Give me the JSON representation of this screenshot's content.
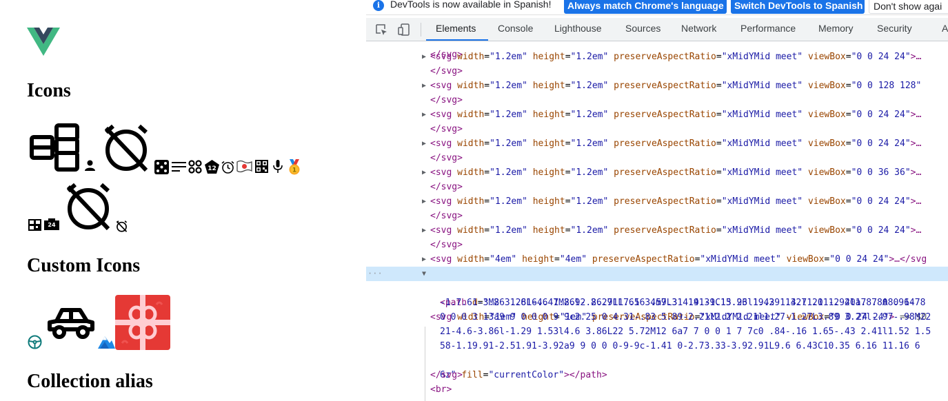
{
  "page": {
    "logo": "vue-logo",
    "headings": {
      "icons": "Icons",
      "custom_icons": "Custom Icons",
      "collection_alias": "Collection alias"
    },
    "icons": [
      "dashboard-icon",
      "person-icon",
      "alarm-off-icon",
      "dice-icon",
      "text-align-icon",
      "apps-icon",
      "badge-12-icon",
      "clock-icon",
      "flag-japan-icon",
      "qr-code-icon",
      "microphone-icon",
      "medal-gold-icon",
      "qr-code-icon",
      "24-hours-icon",
      "alarm-off-icon",
      "alarm-off-icon"
    ],
    "custom_icons": [
      "steering-wheel-icon",
      "car-icon",
      "mountains-icon",
      "gift-icon"
    ],
    "colors": {
      "vue_green": "#41b883",
      "vue_dark": "#34495e",
      "gift_red": "#e53935",
      "steering_teal": "#0e7a7a"
    }
  },
  "devtools": {
    "infobar": {
      "text": "DevTools is now available in Spanish!",
      "match_button": "Always match Chrome's language",
      "switch_button": "Switch DevTools to Spanish",
      "dismiss_button": "Don't show agai"
    },
    "tabs": [
      {
        "label": "Elements",
        "active": true
      },
      {
        "label": "Console"
      },
      {
        "label": "Lighthouse"
      },
      {
        "label": "Sources"
      },
      {
        "label": "Network"
      },
      {
        "label": "Performance"
      },
      {
        "label": "Memory"
      },
      {
        "label": "Security"
      },
      {
        "label": "A"
      }
    ],
    "dom_lines": {
      "close_top": "</svg>",
      "svg1": {
        "w": "1.2em",
        "h": "1.2em",
        "par": "xMidYMid meet",
        "vb": "0 0 24 24",
        "tail": ">…"
      },
      "svg2": {
        "w": "1.2em",
        "h": "1.2em",
        "par": "xMidYMid meet",
        "vb": "0 0 128 128",
        "tail": ""
      },
      "svg3": {
        "w": "1.2em",
        "h": "1.2em",
        "par": "xMidYMid meet",
        "vb": "0 0 24 24",
        "tail": ">…"
      },
      "svg4": {
        "w": "1.2em",
        "h": "1.2em",
        "par": "xMidYMid meet",
        "vb": "0 0 24 24",
        "tail": ">…"
      },
      "svg5": {
        "w": "1.2em",
        "h": "1.2em",
        "par": "xMidYMid meet",
        "vb": "0 0 36 36",
        "tail": ">…"
      },
      "svg6": {
        "w": "1.2em",
        "h": "1.2em",
        "par": "xMidYMid meet",
        "vb": "0 0 24 24",
        "tail": ">…"
      },
      "svg7": {
        "w": "1.2em",
        "h": "1.2em",
        "par": "xMidYMid meet",
        "vb": "0 0 24 24",
        "tail": ">…"
      },
      "svg8": {
        "w": "4em",
        "h": "4em",
        "par": "xMidYMid meet",
        "vb": "0 0 24 24",
        "tail": ">…</svg"
      },
      "svg9": {
        "w": "1em",
        "h": "1em",
        "par": "xMidYMid meet",
        "vb": "0 0 24 24",
        "tail": " == $0"
      },
      "path_d": [
        "M8 3.28L6.6 1.86l-.86.71L7.16 4m9.31 14.39C15.26 19.39 13.7 20 12 20a7 7 0 0 1-7",
        "-1.7.61-3.26 1.61-4.47M2.92 2.29L1.65 3.57L3 4.91-1.13.93l1.42 1.42l1.11-.94l1.8.8A8.964 8",
        "0 0 0 3 13a9 9 0 0 0 9 9c2.25 0 4.31-.83 5.89-2.21l2.2 2.21l1.27-1.27L3.89 3.27l-.97-.98M22",
        "21-4.6-3.86l-1.29 1.53l4.6 3.86L22 5.72M12 6a7 7 0 0 1 7 7c0 .84-.16 1.65-.43 2.41l1.52 1.5",
        "58-1.19.91-2.51.91-3.92a9 9 0 0 0-9-9c-1.41 0-2.73.33-3.92.91L9.6 6.43C10.35 6.16 11.16 6",
        "6z"
      ],
      "fill": "currentColor",
      "br": "<br>"
    }
  }
}
